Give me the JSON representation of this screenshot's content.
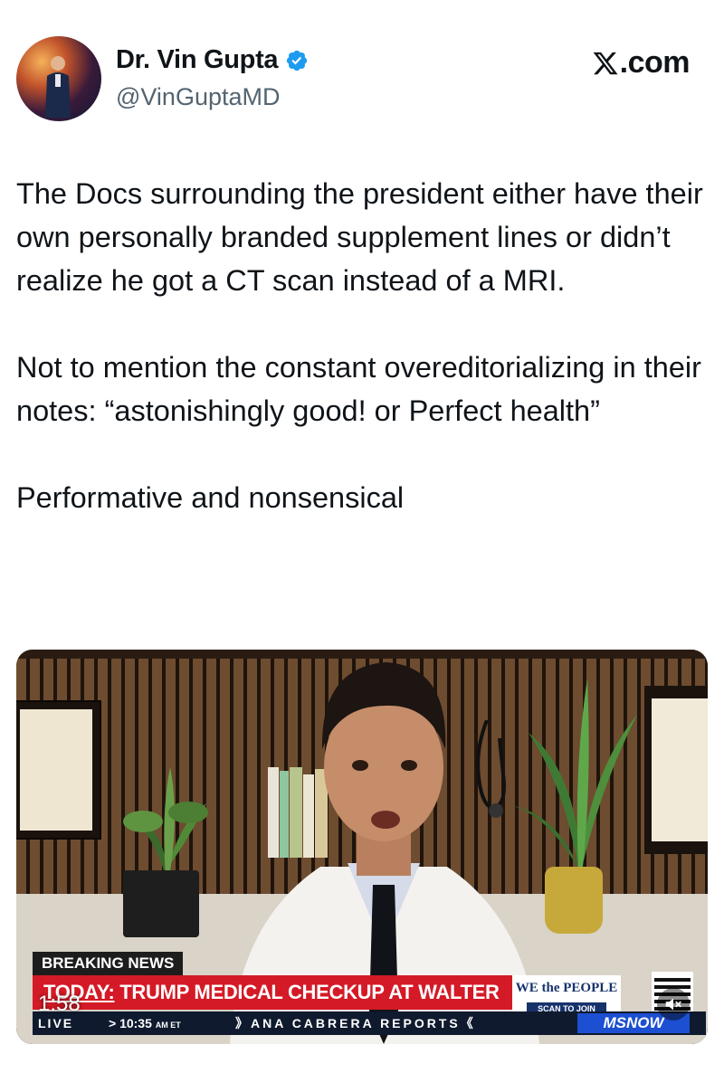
{
  "author": {
    "name": "Dr. Vin Gupta",
    "handle": "@VinGuptaMD",
    "verified_icon": "verified-badge-icon",
    "verified_color": "#1d9bf0"
  },
  "brand": {
    "label": ".com",
    "icon": "x-logo-icon"
  },
  "tweet": {
    "paragraphs": [
      "The Docs surrounding the president either have their own personally branded supplement lines or didn’t realize he got a CT scan instead of a MRI.",
      "Not to mention the constant overeditorializing in their notes: “astonishingly good! or Perfect health”",
      "Performative and nonsensical"
    ]
  },
  "video": {
    "breaking_label": "BREAKING NEWS",
    "headline_prefix": "TODAY:",
    "headline_rest": " TRUMP MEDICAL CHECKUP AT WALTER REED",
    "live_label": "LIVE",
    "clock": "> 10:35",
    "clock_suffix": "AM ET",
    "show_name": "》ANA CABRERA REPORTS《",
    "promo_title": "WE the PEOPLE",
    "promo_cta": "SCAN TO JOIN",
    "network_logo": "MSNOW",
    "elapsed": "1:58",
    "mute_icon": "muted-speaker-icon",
    "accent_red": "#d41a26",
    "ticker_navy": "#0f1a2e"
  }
}
